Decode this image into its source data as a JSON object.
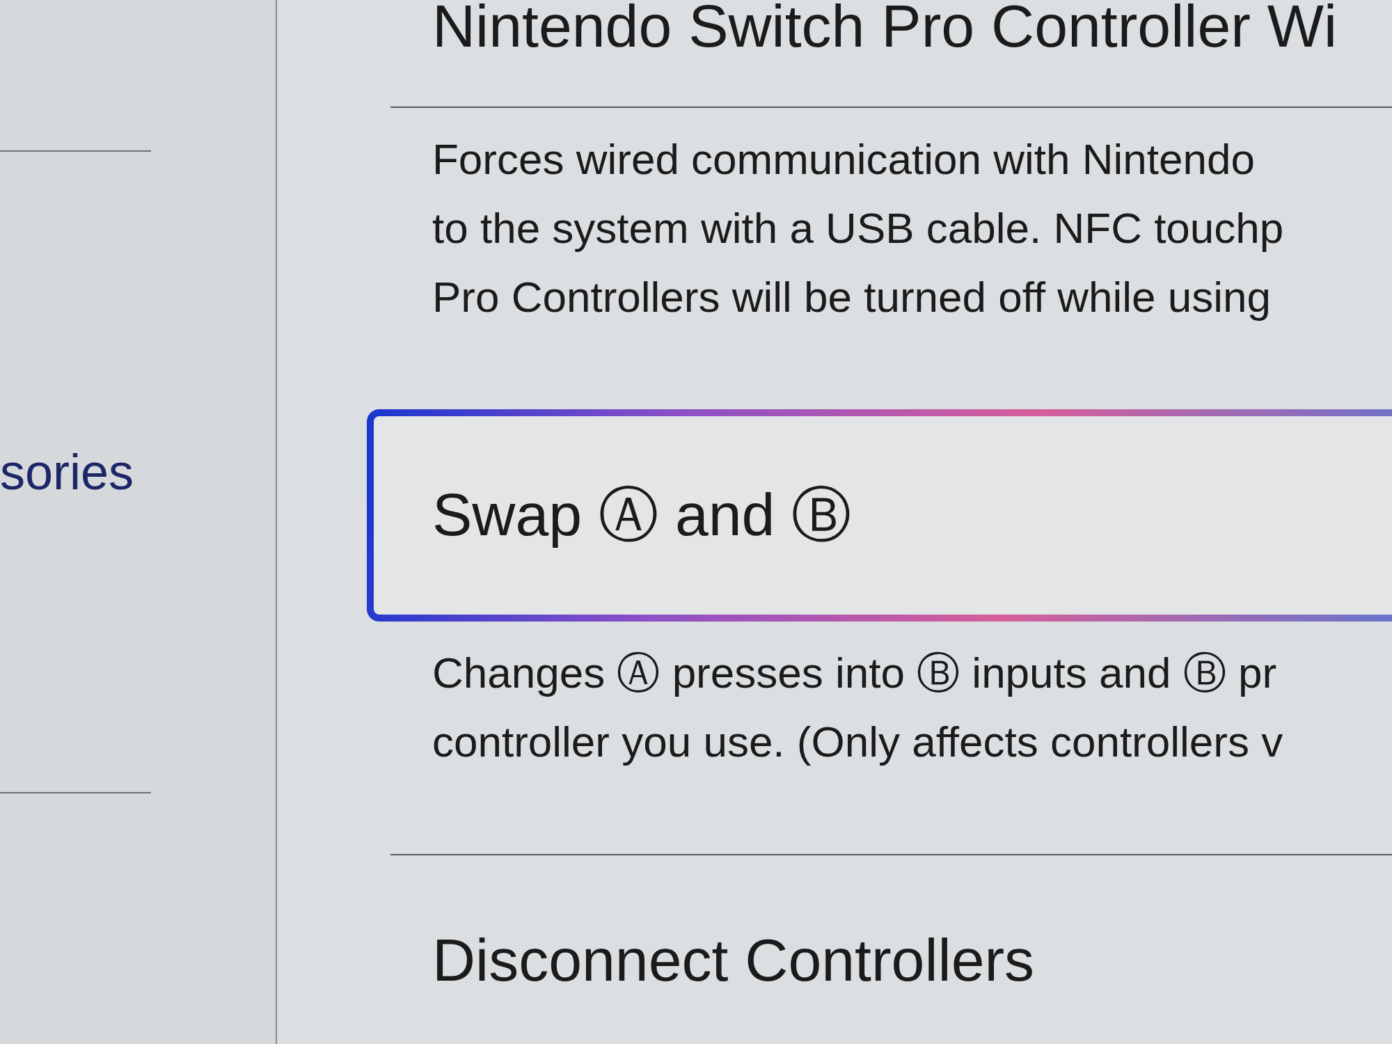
{
  "sidebar": {
    "items": [
      {
        "label": "sories",
        "selected": true
      }
    ]
  },
  "settings": [
    {
      "title": "Nintendo Switch Pro Controller Wi",
      "selected": false,
      "description_lines": [
        "Forces wired communication with Nintendo",
        "to the system with a USB cable. NFC touchp",
        "Pro Controllers will be turned off while using"
      ]
    },
    {
      "title": "Swap Ⓐ and Ⓑ",
      "selected": true,
      "description_lines": [
        "Changes Ⓐ presses into Ⓑ inputs and Ⓑ pr",
        "controller you use. (Only affects controllers v"
      ]
    },
    {
      "title": "Disconnect Controllers",
      "selected": false
    }
  ]
}
